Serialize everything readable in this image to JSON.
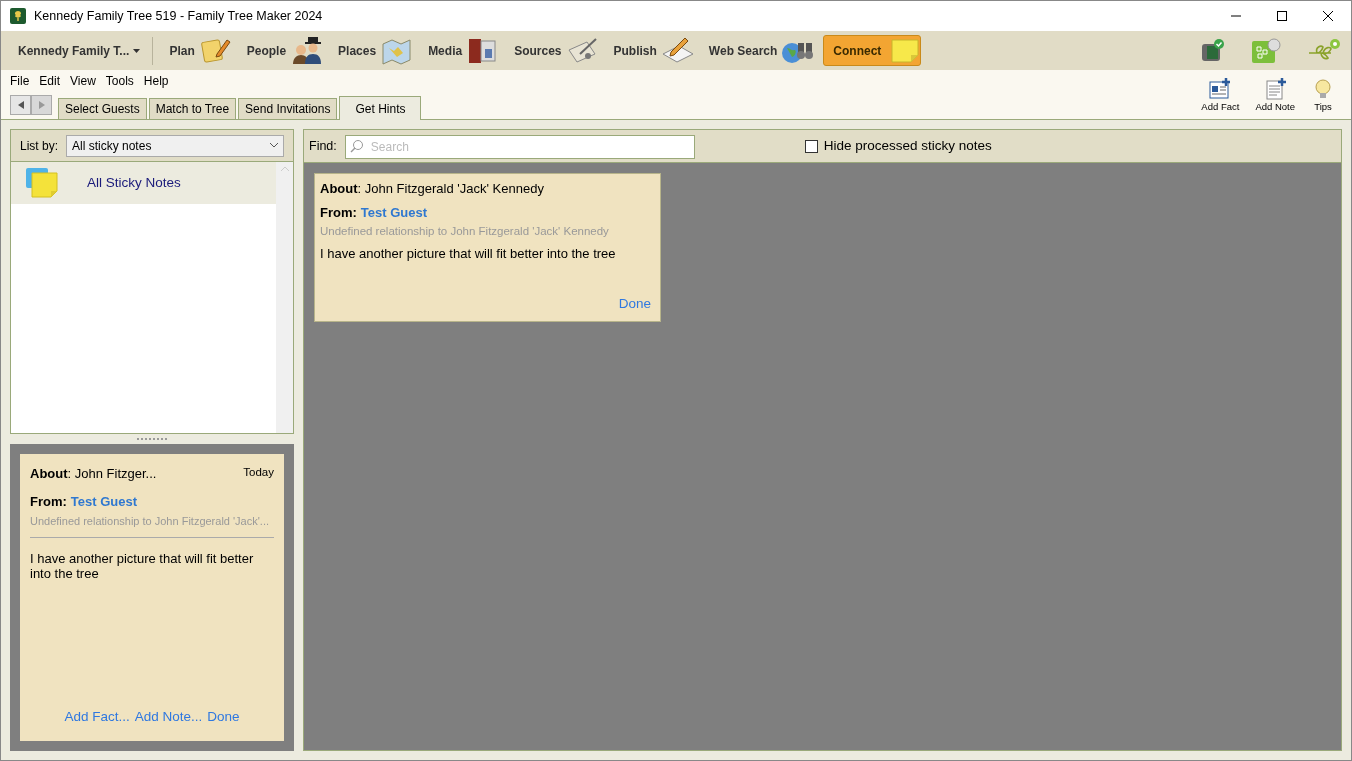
{
  "window": {
    "title": "Kennedy Family Tree 519 - Family Tree Maker 2024"
  },
  "nav": {
    "tree_name": "Kennedy Family T...",
    "items": [
      {
        "label": "Plan",
        "kind": "plan"
      },
      {
        "label": "People",
        "kind": "people"
      },
      {
        "label": "Places",
        "kind": "places"
      },
      {
        "label": "Media",
        "kind": "media"
      },
      {
        "label": "Sources",
        "kind": "sources"
      },
      {
        "label": "Publish",
        "kind": "publish"
      },
      {
        "label": "Web Search",
        "kind": "websearch"
      }
    ],
    "connect": "Connect"
  },
  "menu": [
    "File",
    "Edit",
    "View",
    "Tools",
    "Help"
  ],
  "tabs": [
    {
      "label": "Select Guests",
      "selected": false
    },
    {
      "label": "Match to Tree",
      "selected": false
    },
    {
      "label": "Send Invitations",
      "selected": false
    },
    {
      "label": "Get Hints",
      "selected": true
    }
  ],
  "toolbar": [
    {
      "label": "Add Fact",
      "kind": "fact"
    },
    {
      "label": "Add Note",
      "kind": "note"
    },
    {
      "label": "Tips",
      "kind": "tips"
    }
  ],
  "list_panel": {
    "label": "List by:",
    "dropdown": "All sticky notes",
    "items": [
      {
        "label": "All Sticky Notes",
        "selected": true
      }
    ]
  },
  "preview": {
    "about": "**About**: John Fitzger...",
    "date": "Today",
    "from_label": "From:",
    "from": "Test Guest",
    "relationship": "Undefined relationship to John Fitzgerald 'Jack'...",
    "message": "I have another picture that will fit better into the tree",
    "actions": [
      "Add Fact...",
      "Add Note...",
      "Done"
    ]
  },
  "find": {
    "label": "Find:",
    "placeholder": "Search",
    "hide_processed": {
      "label": "Hide processed sticky notes",
      "checked": false
    }
  },
  "notes": [
    {
      "about": "**About**: John Fitzgerald 'Jack' Kennedy",
      "from_label": "From:",
      "from": "Test Guest",
      "relationship": "Undefined relationship to John Fitzgerald 'Jack' Kennedy",
      "message": "I have another picture that will fit better into the tree",
      "action": "Done"
    }
  ]
}
